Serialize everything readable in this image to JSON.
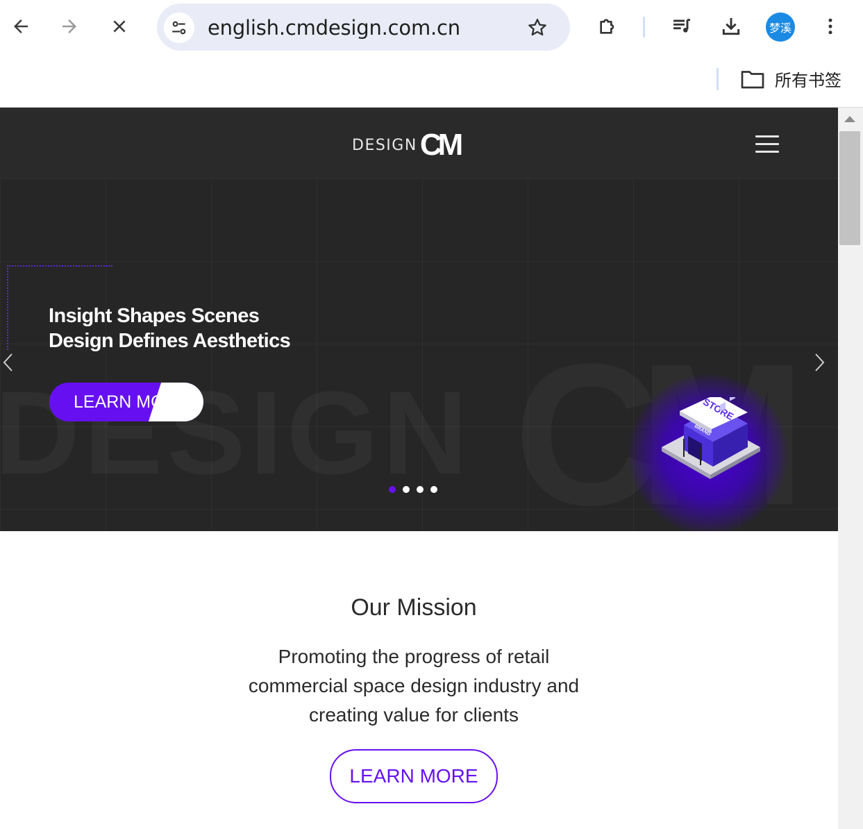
{
  "browser": {
    "url": "english.cmdesign.com.cn",
    "profile_name": "梦溪",
    "bookmarks_folder_label": "所有书签",
    "icons": {
      "back": "arrow-left-icon",
      "forward": "arrow-right-icon",
      "stop": "close-icon",
      "site_info": "tune-icon",
      "bookmark_star": "star-icon",
      "extensions": "puzzle-icon",
      "media": "playlist-music-icon",
      "downloads": "download-icon",
      "menu": "more-vertical-icon",
      "folder": "folder-icon"
    }
  },
  "site": {
    "logo_text": "DESIGN",
    "logo_mark": "CM",
    "hero": {
      "title_line1": "Insight Shapes Scenes",
      "title_line2": "Design Defines Aesthetics",
      "cta_label": "LEARN MORE",
      "watermark": "DESIGN",
      "watermark_mark": "CM",
      "store_sign": "STORE",
      "store_sub_sign": "BRAND",
      "slides_total": 4,
      "active_slide": 1
    },
    "mission": {
      "title": "Our Mission",
      "text": "Promoting the progress of retail commercial space design industry and creating value for clients",
      "button_label": "LEARN MORE"
    },
    "colors": {
      "accent": "#6610f2",
      "header_bg": "#2a2a2a",
      "hero_bg": "#262626"
    }
  }
}
